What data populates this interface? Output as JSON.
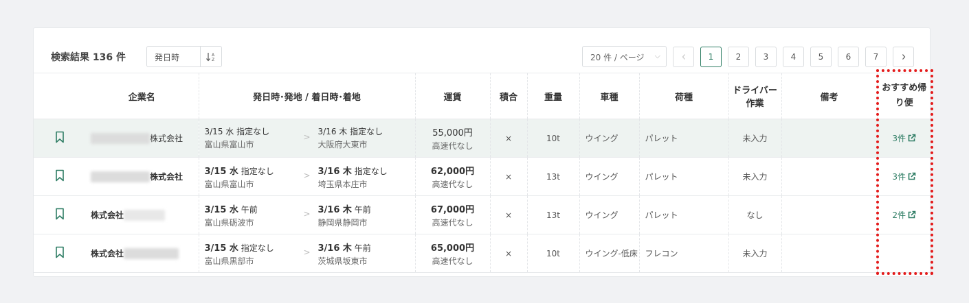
{
  "toolbar": {
    "result_label": "検索結果 136 件",
    "sort_value": "発日時",
    "page_size": "20 件 / ページ",
    "pages": [
      "1",
      "2",
      "3",
      "4",
      "5",
      "6",
      "7"
    ],
    "current_page": "1",
    "prev_icon": "chevron-left-icon",
    "next_icon": "chevron-right-icon"
  },
  "columns": {
    "company": "企業名",
    "route": "発日時･発地 / 着日時･着地",
    "fare": "運賃",
    "mixed": "積合",
    "weight": "重量",
    "vehicle": "車種",
    "cargo": "荷種",
    "driver_work": "ドライバー作業",
    "notes": "備考",
    "recommend": "おすすめ帰り便"
  },
  "rows": [
    {
      "company": "株式会社",
      "dep_date": "3/15 水",
      "dep_time": "指定なし",
      "dep_place": "富山県富山市",
      "arr_date": "3/16 木",
      "arr_time": "指定なし",
      "arr_place": "大阪府大東市",
      "fare": "55,000円",
      "toll": "高速代なし",
      "mixed": "×",
      "weight": "10t",
      "vehicle": "ウイング",
      "cargo": "パレット",
      "driver_work": "未入力",
      "notes": "",
      "recommend": "3件"
    },
    {
      "company": "株式会社",
      "dep_date": "3/15 水",
      "dep_time": "指定なし",
      "dep_place": "富山県富山市",
      "arr_date": "3/16 木",
      "arr_time": "指定なし",
      "arr_place": "埼玉県本庄市",
      "fare": "62,000円",
      "toll": "高速代なし",
      "mixed": "×",
      "weight": "13t",
      "vehicle": "ウイング",
      "cargo": "パレット",
      "driver_work": "未入力",
      "notes": "",
      "recommend": "3件"
    },
    {
      "company": "株式会社",
      "dep_date": "3/15 水",
      "dep_time": "午前",
      "dep_place": "富山県砺波市",
      "arr_date": "3/16 木",
      "arr_time": "午前",
      "arr_place": "静岡県静岡市",
      "fare": "67,000円",
      "toll": "高速代なし",
      "mixed": "×",
      "weight": "13t",
      "vehicle": "ウイング",
      "cargo": "パレット",
      "driver_work": "なし",
      "notes": "",
      "recommend": "2件"
    },
    {
      "company": "株式会社",
      "dep_date": "3/15 水",
      "dep_time": "指定なし",
      "dep_place": "富山県黒部市",
      "arr_date": "3/16 木",
      "arr_time": "午前",
      "arr_place": "茨城県坂東市",
      "fare": "65,000円",
      "toll": "高速代なし",
      "mixed": "×",
      "weight": "10t",
      "vehicle": "ウイング-低床",
      "cargo": "フレコン",
      "driver_work": "未入力",
      "notes": "",
      "recommend": ""
    }
  ],
  "colors": {
    "accent": "#2e7d64",
    "highlight_row": "#eef3f1",
    "annotation": "#e41b1b"
  }
}
